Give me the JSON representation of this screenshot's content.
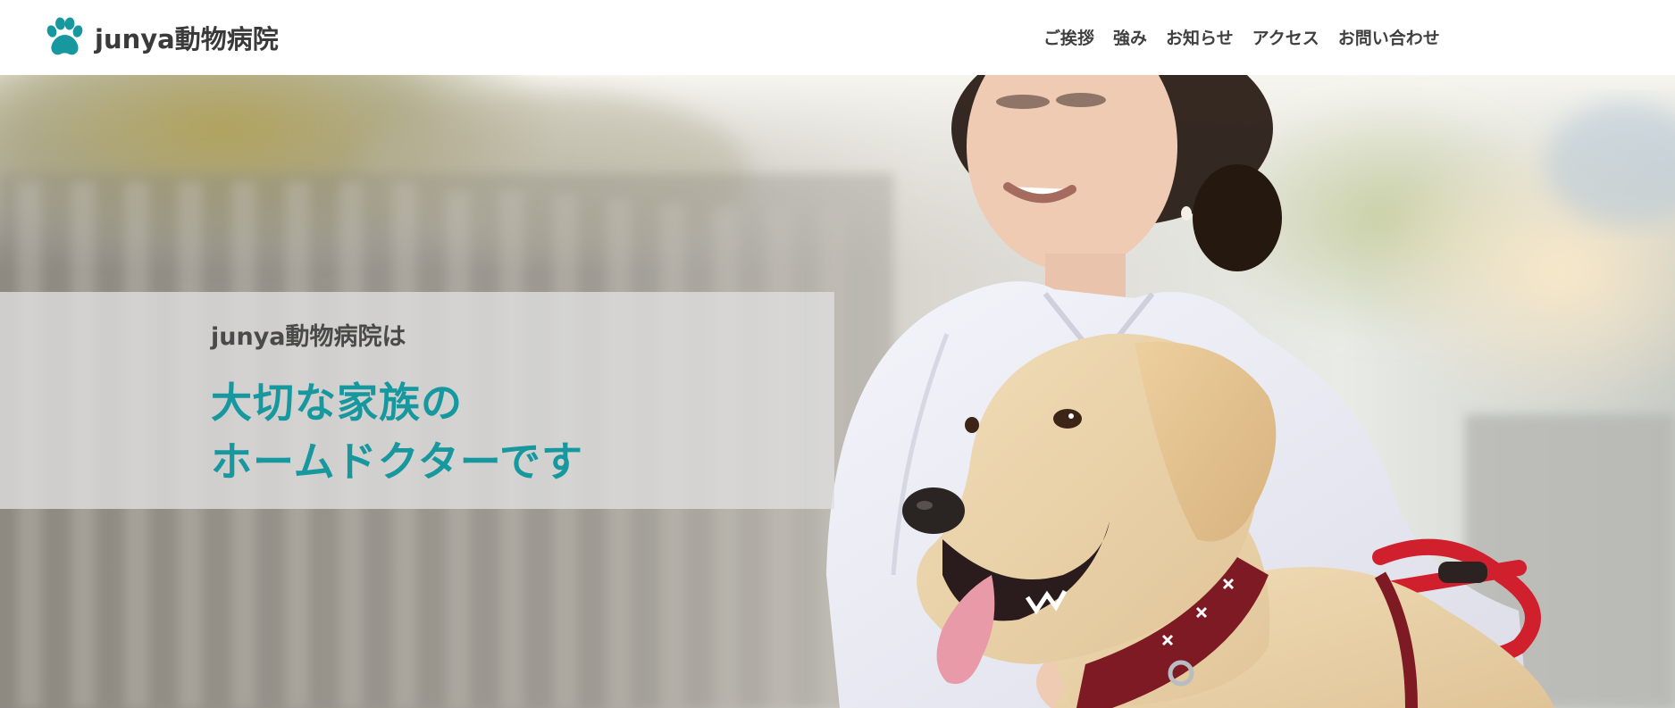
{
  "header": {
    "logo_text": "junya動物病院",
    "logo_icon": "paw-icon",
    "brand_color": "#17989f"
  },
  "nav": {
    "items": [
      {
        "label": "ご挨拶"
      },
      {
        "label": "強み"
      },
      {
        "label": "お知らせ"
      },
      {
        "label": "アクセス"
      },
      {
        "label": "お問い合わせ"
      }
    ]
  },
  "hero": {
    "tagline_small": "junya動物病院は",
    "tagline_line1": "大切な家族の",
    "tagline_line2": "ホームドクターです",
    "image_subject": "veterinarian-with-labrador-dog"
  }
}
